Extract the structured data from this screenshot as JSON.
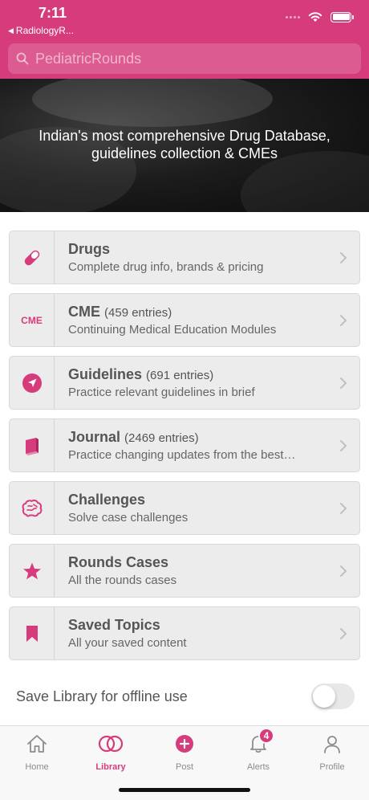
{
  "status": {
    "time": "7:11",
    "back_app": "RadiologyR..."
  },
  "search": {
    "placeholder": "PediatricRounds"
  },
  "banner": {
    "text": "Indian's most comprehensive Drug Database, guidelines collection & CMEs"
  },
  "items": [
    {
      "icon": "pill-icon",
      "title": "Drugs",
      "count": "",
      "subtitle": "Complete drug info, brands & pricing"
    },
    {
      "icon": "cme-icon",
      "icon_text": "CME",
      "title": "CME",
      "count": "(459 entries)",
      "subtitle": "Continuing Medical Education Modules"
    },
    {
      "icon": "navigation-arrow-icon",
      "title": "Guidelines",
      "count": "(691 entries)",
      "subtitle": "Practice relevant guidelines in brief"
    },
    {
      "icon": "book-icon",
      "title": "Journal",
      "count": "(2469 entries)",
      "subtitle": "Practice changing updates from the best…"
    },
    {
      "icon": "brain-icon",
      "title": "Challenges",
      "count": "",
      "subtitle": "Solve case challenges"
    },
    {
      "icon": "star-icon",
      "title": "Rounds Cases",
      "count": "",
      "subtitle": "All the rounds cases"
    },
    {
      "icon": "bookmark-icon",
      "title": "Saved Topics",
      "count": "",
      "subtitle": "All your saved content"
    }
  ],
  "offline": {
    "label": "Save Library for offline use",
    "enabled": false
  },
  "tabs": [
    {
      "label": "Home",
      "icon": "home-icon",
      "active": false
    },
    {
      "label": "Library",
      "icon": "library-rings-icon",
      "active": true
    },
    {
      "label": "Post",
      "icon": "plus-circle-icon",
      "active": false
    },
    {
      "label": "Alerts",
      "icon": "bell-icon",
      "active": false,
      "badge": "4"
    },
    {
      "label": "Profile",
      "icon": "person-icon",
      "active": false
    }
  ],
  "colors": {
    "accent": "#d63c7b",
    "card_bg": "#ececec",
    "inactive": "#8c8c8c"
  }
}
